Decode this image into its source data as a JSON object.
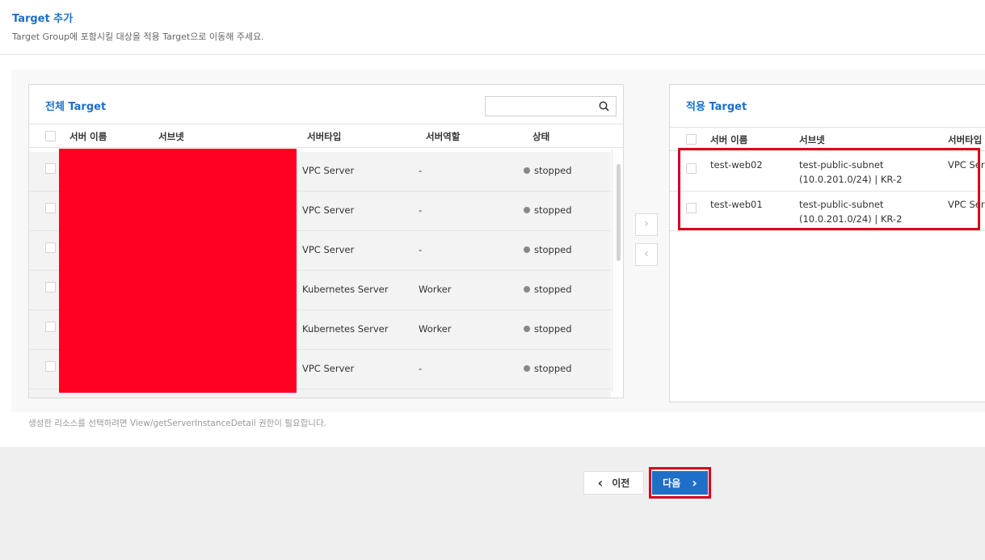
{
  "header": {
    "title": "Target 추가",
    "subtitle": "Target Group에 포함시킬 대상을 적용 Target으로 이동해 주세요."
  },
  "left_panel": {
    "title": "전체 Target",
    "search": {
      "placeholder": "",
      "value": ""
    },
    "columns": [
      "서버 이름",
      "서브넷",
      "서버타입",
      "서버역할",
      "상태"
    ],
    "rows": [
      {
        "server_name": "",
        "subnet": "",
        "server_type": "VPC Server",
        "server_role": "-",
        "status": "stopped"
      },
      {
        "server_name": "",
        "subnet": "",
        "server_type": "VPC Server",
        "server_role": "-",
        "status": "stopped"
      },
      {
        "server_name": "",
        "subnet": "",
        "server_type": "VPC Server",
        "server_role": "-",
        "status": "stopped"
      },
      {
        "server_name": "",
        "subnet": "",
        "server_type": "Kubernetes Server",
        "server_role": "Worker",
        "status": "stopped"
      },
      {
        "server_name": "",
        "subnet": "",
        "server_type": "Kubernetes Server",
        "server_role": "Worker",
        "status": "stopped"
      },
      {
        "server_name": "",
        "subnet": "",
        "server_type": "VPC Server",
        "server_role": "-",
        "status": "stopped"
      }
    ]
  },
  "right_panel": {
    "title": "적용 Target",
    "columns": [
      "서버 이름",
      "서브넷",
      "서버타입"
    ],
    "rows": [
      {
        "server_name": "test-web02",
        "subnet_line1": "test-public-subnet",
        "subnet_line2": "(10.0.201.0/24) | KR-2",
        "server_type": "VPC Server"
      },
      {
        "server_name": "test-web01",
        "subnet_line1": "test-public-subnet",
        "subnet_line2": "(10.0.201.0/24) | KR-2",
        "server_type": "VPC Server"
      }
    ]
  },
  "transfer": {
    "move_right_icon": "chevron-right-icon",
    "move_left_icon": "chevron-left-icon"
  },
  "note": "생성한 리소스를 선택하려면 View/getServerInstanceDetail 권한이 필요합니다.",
  "footer": {
    "prev_label": "이전",
    "next_label": "다음"
  },
  "colors": {
    "accent": "#1e6fc8",
    "highlight": "#d6001c",
    "redaction": "#ff0022",
    "status_stopped": "#888888"
  }
}
